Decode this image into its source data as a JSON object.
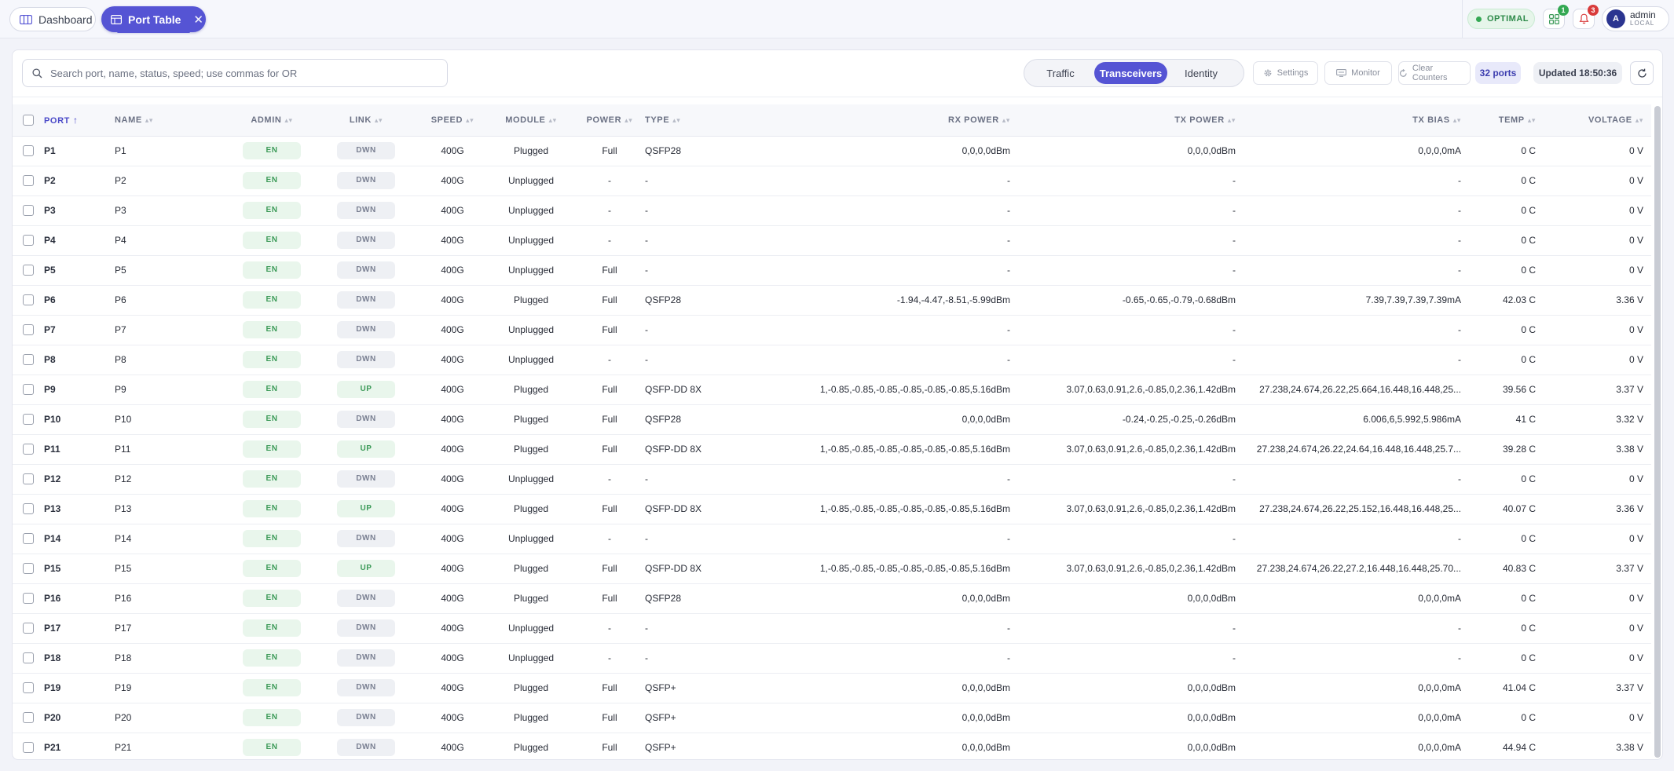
{
  "header": {
    "tabs": [
      {
        "label": "Dashboard",
        "icon": "columns-icon"
      },
      {
        "label": "Port Table",
        "icon": "table-icon"
      }
    ],
    "status": "OPTIMAL",
    "apps_badge": "1",
    "alerts_badge": "3",
    "user": {
      "initial": "A",
      "name": "admin",
      "realm": "LOCAL"
    }
  },
  "toolbar": {
    "search_placeholder": "Search port, name, status, speed; use commas for OR",
    "views": [
      "Traffic",
      "Transceivers",
      "Identity"
    ],
    "active_view": "Transceivers",
    "settings": "Settings",
    "monitor": "Monitor",
    "clear_counters": "Clear Counters",
    "ports_count": "32 ports",
    "updated": "Updated 18:50:36"
  },
  "table": {
    "columns": [
      "PORT",
      "NAME",
      "ADMIN",
      "LINK",
      "SPEED",
      "MODULE",
      "POWER",
      "TYPE",
      "RX POWER",
      "TX POWER",
      "TX BIAS",
      "TEMP",
      "VOLTAGE"
    ],
    "sorted_column": "PORT",
    "sort_direction": "ascending",
    "rows": [
      {
        "port": "P1",
        "name": "P1",
        "admin": "EN",
        "link": "DWN",
        "speed": "400G",
        "module": "Plugged",
        "power": "Full",
        "type": "QSFP28",
        "rx": "0,0,0,0dBm",
        "tx": "0,0,0,0dBm",
        "bias": "0,0,0,0mA",
        "temp": "0 C",
        "volt": "0 V"
      },
      {
        "port": "P2",
        "name": "P2",
        "admin": "EN",
        "link": "DWN",
        "speed": "400G",
        "module": "Unplugged",
        "power": "-",
        "type": "-",
        "rx": "-",
        "tx": "-",
        "bias": "-",
        "temp": "0 C",
        "volt": "0 V"
      },
      {
        "port": "P3",
        "name": "P3",
        "admin": "EN",
        "link": "DWN",
        "speed": "400G",
        "module": "Unplugged",
        "power": "-",
        "type": "-",
        "rx": "-",
        "tx": "-",
        "bias": "-",
        "temp": "0 C",
        "volt": "0 V"
      },
      {
        "port": "P4",
        "name": "P4",
        "admin": "EN",
        "link": "DWN",
        "speed": "400G",
        "module": "Unplugged",
        "power": "-",
        "type": "-",
        "rx": "-",
        "tx": "-",
        "bias": "-",
        "temp": "0 C",
        "volt": "0 V"
      },
      {
        "port": "P5",
        "name": "P5",
        "admin": "EN",
        "link": "DWN",
        "speed": "400G",
        "module": "Unplugged",
        "power": "Full",
        "type": "-",
        "rx": "-",
        "tx": "-",
        "bias": "-",
        "temp": "0 C",
        "volt": "0 V"
      },
      {
        "port": "P6",
        "name": "P6",
        "admin": "EN",
        "link": "DWN",
        "speed": "400G",
        "module": "Plugged",
        "power": "Full",
        "type": "QSFP28",
        "rx": "-1.94,-4.47,-8.51,-5.99dBm",
        "tx": "-0.65,-0.65,-0.79,-0.68dBm",
        "bias": "7.39,7.39,7.39,7.39mA",
        "temp": "42.03 C",
        "volt": "3.36 V"
      },
      {
        "port": "P7",
        "name": "P7",
        "admin": "EN",
        "link": "DWN",
        "speed": "400G",
        "module": "Unplugged",
        "power": "Full",
        "type": "-",
        "rx": "-",
        "tx": "-",
        "bias": "-",
        "temp": "0 C",
        "volt": "0 V"
      },
      {
        "port": "P8",
        "name": "P8",
        "admin": "EN",
        "link": "DWN",
        "speed": "400G",
        "module": "Unplugged",
        "power": "-",
        "type": "-",
        "rx": "-",
        "tx": "-",
        "bias": "-",
        "temp": "0 C",
        "volt": "0 V"
      },
      {
        "port": "P9",
        "name": "P9",
        "admin": "EN",
        "link": "UP",
        "speed": "400G",
        "module": "Plugged",
        "power": "Full",
        "type": "QSFP-DD 8X",
        "rx": "1,-0.85,-0.85,-0.85,-0.85,-0.85,-0.85,5.16dBm",
        "tx": "3.07,0.63,0.91,2.6,-0.85,0,2.36,1.42dBm",
        "bias": "27.238,24.674,26.22,25.664,16.448,16.448,25...",
        "temp": "39.56 C",
        "volt": "3.37 V"
      },
      {
        "port": "P10",
        "name": "P10",
        "admin": "EN",
        "link": "DWN",
        "speed": "400G",
        "module": "Plugged",
        "power": "Full",
        "type": "QSFP28",
        "rx": "0,0,0,0dBm",
        "tx": "-0.24,-0.25,-0.25,-0.26dBm",
        "bias": "6.006,6,5.992,5.986mA",
        "temp": "41 C",
        "volt": "3.32 V"
      },
      {
        "port": "P11",
        "name": "P11",
        "admin": "EN",
        "link": "UP",
        "speed": "400G",
        "module": "Plugged",
        "power": "Full",
        "type": "QSFP-DD 8X",
        "rx": "1,-0.85,-0.85,-0.85,-0.85,-0.85,-0.85,5.16dBm",
        "tx": "3.07,0.63,0.91,2.6,-0.85,0,2.36,1.42dBm",
        "bias": "27.238,24.674,26.22,24.64,16.448,16.448,25.7...",
        "temp": "39.28 C",
        "volt": "3.38 V"
      },
      {
        "port": "P12",
        "name": "P12",
        "admin": "EN",
        "link": "DWN",
        "speed": "400G",
        "module": "Unplugged",
        "power": "-",
        "type": "-",
        "rx": "-",
        "tx": "-",
        "bias": "-",
        "temp": "0 C",
        "volt": "0 V"
      },
      {
        "port": "P13",
        "name": "P13",
        "admin": "EN",
        "link": "UP",
        "speed": "400G",
        "module": "Plugged",
        "power": "Full",
        "type": "QSFP-DD 8X",
        "rx": "1,-0.85,-0.85,-0.85,-0.85,-0.85,-0.85,5.16dBm",
        "tx": "3.07,0.63,0.91,2.6,-0.85,0,2.36,1.42dBm",
        "bias": "27.238,24.674,26.22,25.152,16.448,16.448,25...",
        "temp": "40.07 C",
        "volt": "3.36 V"
      },
      {
        "port": "P14",
        "name": "P14",
        "admin": "EN",
        "link": "DWN",
        "speed": "400G",
        "module": "Unplugged",
        "power": "-",
        "type": "-",
        "rx": "-",
        "tx": "-",
        "bias": "-",
        "temp": "0 C",
        "volt": "0 V"
      },
      {
        "port": "P15",
        "name": "P15",
        "admin": "EN",
        "link": "UP",
        "speed": "400G",
        "module": "Plugged",
        "power": "Full",
        "type": "QSFP-DD 8X",
        "rx": "1,-0.85,-0.85,-0.85,-0.85,-0.85,-0.85,5.16dBm",
        "tx": "3.07,0.63,0.91,2.6,-0.85,0,2.36,1.42dBm",
        "bias": "27.238,24.674,26.22,27.2,16.448,16.448,25.70...",
        "temp": "40.83 C",
        "volt": "3.37 V"
      },
      {
        "port": "P16",
        "name": "P16",
        "admin": "EN",
        "link": "DWN",
        "speed": "400G",
        "module": "Plugged",
        "power": "Full",
        "type": "QSFP28",
        "rx": "0,0,0,0dBm",
        "tx": "0,0,0,0dBm",
        "bias": "0,0,0,0mA",
        "temp": "0 C",
        "volt": "0 V"
      },
      {
        "port": "P17",
        "name": "P17",
        "admin": "EN",
        "link": "DWN",
        "speed": "400G",
        "module": "Unplugged",
        "power": "-",
        "type": "-",
        "rx": "-",
        "tx": "-",
        "bias": "-",
        "temp": "0 C",
        "volt": "0 V"
      },
      {
        "port": "P18",
        "name": "P18",
        "admin": "EN",
        "link": "DWN",
        "speed": "400G",
        "module": "Unplugged",
        "power": "-",
        "type": "-",
        "rx": "-",
        "tx": "-",
        "bias": "-",
        "temp": "0 C",
        "volt": "0 V"
      },
      {
        "port": "P19",
        "name": "P19",
        "admin": "EN",
        "link": "DWN",
        "speed": "400G",
        "module": "Plugged",
        "power": "Full",
        "type": "QSFP+",
        "rx": "0,0,0,0dBm",
        "tx": "0,0,0,0dBm",
        "bias": "0,0,0,0mA",
        "temp": "41.04 C",
        "volt": "3.37 V"
      },
      {
        "port": "P20",
        "name": "P20",
        "admin": "EN",
        "link": "DWN",
        "speed": "400G",
        "module": "Plugged",
        "power": "Full",
        "type": "QSFP+",
        "rx": "0,0,0,0dBm",
        "tx": "0,0,0,0dBm",
        "bias": "0,0,0,0mA",
        "temp": "0 C",
        "volt": "0 V"
      },
      {
        "port": "P21",
        "name": "P21",
        "admin": "EN",
        "link": "DWN",
        "speed": "400G",
        "module": "Plugged",
        "power": "Full",
        "type": "QSFP+",
        "rx": "0,0,0,0dBm",
        "tx": "0,0,0,0dBm",
        "bias": "0,0,0,0mA",
        "temp": "44.94 C",
        "volt": "3.38 V"
      }
    ]
  },
  "colors": {
    "accent": "#5554d4",
    "ok": "#34a853",
    "alert": "#d93b3b"
  }
}
